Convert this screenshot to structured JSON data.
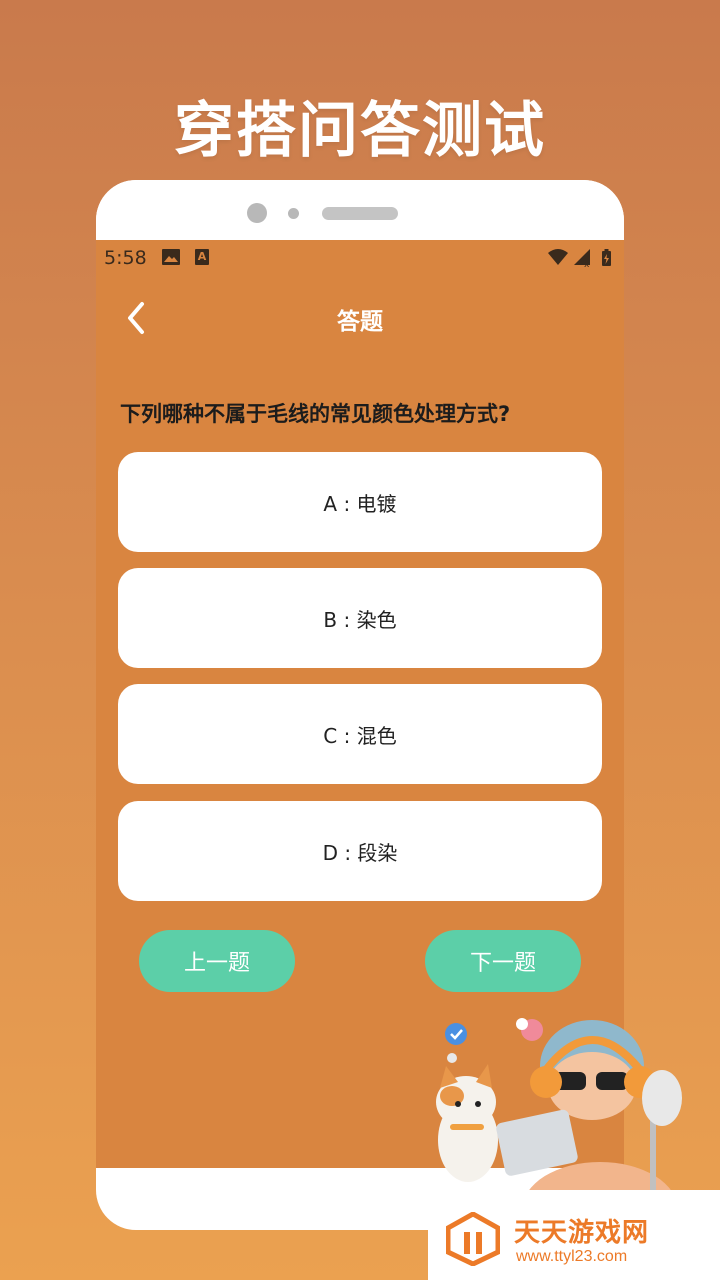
{
  "promo": {
    "title": "穿搭问答测试"
  },
  "status_bar": {
    "time": "5:58",
    "a_icon_text": "A"
  },
  "header": {
    "title": "答题",
    "back_icon": "chevron-left-icon"
  },
  "quiz": {
    "question": "下列哪种不属于毛线的常见颜色处理方式?",
    "options": [
      {
        "label": "A : 电镀"
      },
      {
        "label": "B : 染色"
      },
      {
        "label": "C : 混色"
      },
      {
        "label": "D : 段染"
      }
    ],
    "prev_label": "上一题",
    "next_label": "下一题"
  },
  "watermark": {
    "name": "天天游戏网",
    "url": "www.ttyl23.com"
  },
  "colors": {
    "screen_bg": "#d98540",
    "button_green": "#5ccfa8",
    "watermark_orange": "#ec7a28"
  }
}
